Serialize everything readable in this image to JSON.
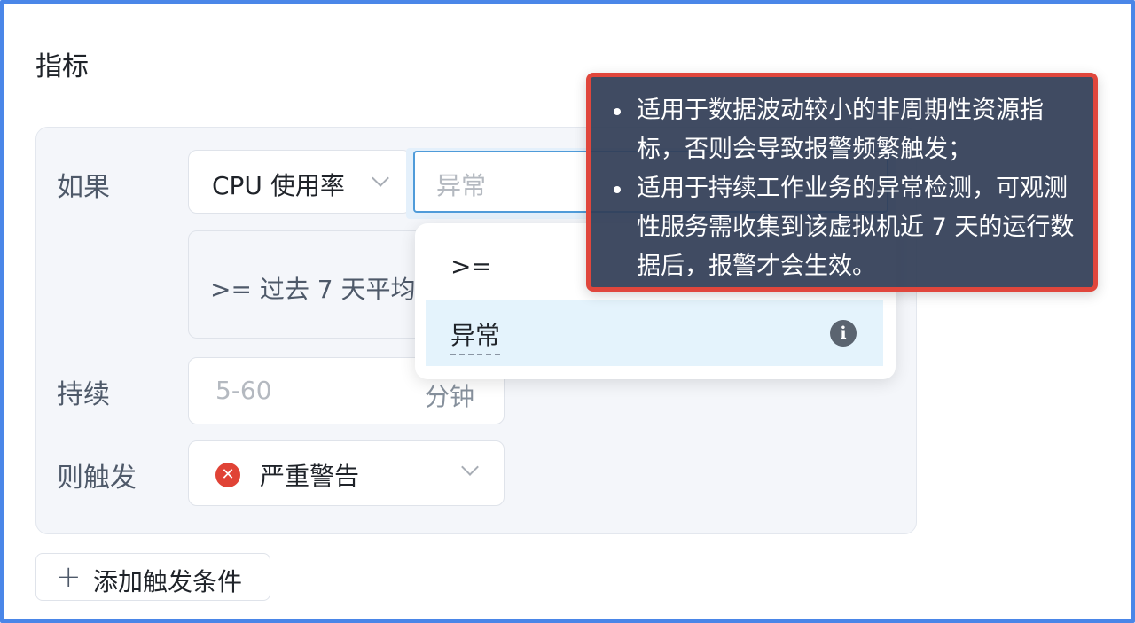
{
  "section": {
    "title": "指标"
  },
  "rule": {
    "if_label": "如果",
    "metric_value": "CPU 使用率",
    "condition_placeholder": "异常",
    "threshold_text": ">= 过去 7 天平均",
    "duration_label": "持续",
    "duration_placeholder": "5-60",
    "duration_unit": "分钟",
    "trigger_label": "则触发",
    "severity_icon": "error-circle-icon",
    "severity_color": "#e04336",
    "severity_value": "严重警告"
  },
  "add_condition": {
    "icon": "plus-icon",
    "label": "添加触发条件"
  },
  "dropdown": {
    "options": [
      {
        "label": ">="
      },
      {
        "label": "异常",
        "icon": "info-icon",
        "selected": true
      }
    ]
  },
  "tooltip": {
    "items": [
      "适用于数据波动较小的非周期性资源指标，否则会导致报警频繁触发；",
      "适用于持续工作业务的异常检测，可观测性服务需收集到该虚拟机近 7 天的运行数据后，报警才会生效。"
    ]
  },
  "colors": {
    "accent": "#4f9bd9",
    "frame": "#4a86e8",
    "tooltip_bg": "#313d56",
    "tooltip_border": "#e0463c"
  }
}
